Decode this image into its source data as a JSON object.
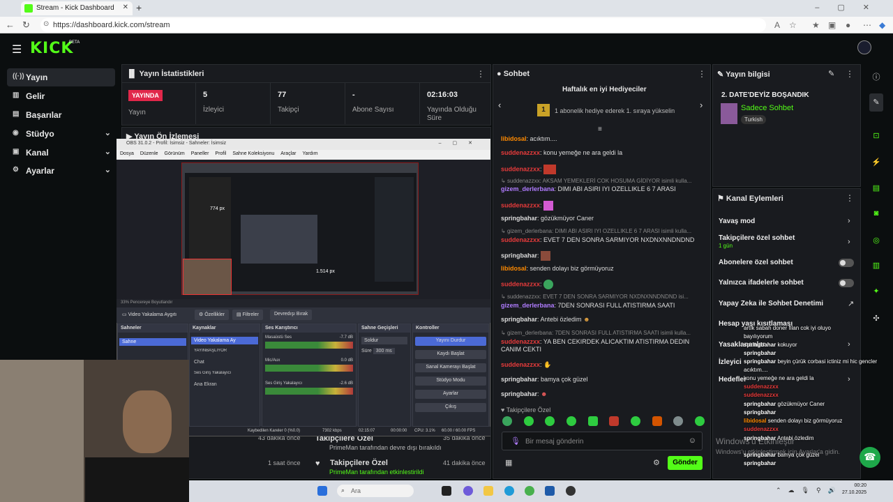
{
  "browser": {
    "tab_title": "Stream - Kick Dashboard",
    "url": "https://dashboard.kick.com/stream"
  },
  "header": {
    "logo": "KICK",
    "beta": "BETA"
  },
  "sidebar": {
    "items": [
      {
        "label": "Yayın",
        "icon": "broadcast-icon"
      },
      {
        "label": "Gelir",
        "icon": "money-icon"
      },
      {
        "label": "Başarılar",
        "icon": "trophy-icon"
      },
      {
        "label": "Stüdyo",
        "icon": "studio-icon"
      },
      {
        "label": "Kanal",
        "icon": "channel-icon"
      },
      {
        "label": "Ayarlar",
        "icon": "gear-icon"
      }
    ]
  },
  "stats": {
    "title": "Yayın İstatistikleri",
    "badge": "YAYINDA",
    "status_label": "Yayın",
    "viewers_value": "5",
    "viewers_label": "İzleyici",
    "followers_value": "77",
    "followers_label": "Takipçi",
    "subs_value": "-",
    "subs_label": "Abone Sayısı",
    "duration_value": "02:16:03",
    "duration_label": "Yayında Olduğu Süre"
  },
  "preview": {
    "title": "Yayın Ön İzlemesi"
  },
  "obs": {
    "title": "OBS 31.0.2 - Profil: İsimsiz - Sahneler: İsimsiz",
    "menu": [
      "Dosya",
      "Düzenle",
      "Görünüm",
      "Paneller",
      "Profil",
      "Sahne Koleksiyonu",
      "Araçlar",
      "Yardım"
    ],
    "zoom": "33%  Pencereye Boyutlandır",
    "source_name": "Video Yakalama Aygıtı",
    "toolbar": [
      "Özellikler",
      "Filtreler",
      "Devredışı Bırak"
    ],
    "docks": {
      "scenes": "Sahneler",
      "scene_item": "Sahne",
      "sources": "Kaynaklar",
      "source_items": [
        "Video Yakalama Ay",
        "YAYINBAŞLIYOR",
        "Chat",
        "Ses Giriş Yakalayıcı",
        "Ana Ekran"
      ],
      "mixer": "Ses Karıştırıcı",
      "mixer_items": [
        {
          "name": "Masaüstü Ses",
          "db": "-7.7 dB"
        },
        {
          "name": "Mic/Aux",
          "db": "0.0 dB"
        },
        {
          "name": "Ses Giriş Yakalayıcı",
          "db": "-2.6 dB"
        }
      ],
      "transitions": "Sahne Geçişleri",
      "transition_value": "Soldur",
      "duration_label": "Süre",
      "duration_value": "300 ms",
      "controls": "Kontroller",
      "control_items": [
        "Yayını Durdur",
        "Kaydı Başlat",
        "Sanal Kamerayı Başlat",
        "Stüdyo Modu",
        "Ayarlar",
        "Çıkış"
      ]
    },
    "footer": {
      "dropped": "Kaybedilen Kareler 0 (%0.0)",
      "kbps": "7302 kbps",
      "time1": "02:15:07",
      "time2": "00:00:00",
      "cpu": "CPU: 3.1%",
      "fps": "60.00 / 60.00 FPS"
    },
    "preview_label": "774 px",
    "preview_label2": "1.514 px"
  },
  "activity": [
    {
      "title": "Takipçilere Özel",
      "sub": "PrimeMan tarafından devre dışı bırakıldı",
      "time": "35 dakika önce",
      "prev_time": "43 dakika önce"
    },
    {
      "title": "Takipçilere Özel",
      "sub": "PrimeMan tarafından etkinleştirildi",
      "time": "41 dakika önce",
      "prev_time": "1 saat önce"
    }
  ],
  "chat": {
    "title": "Sohbet",
    "gifters_title": "Haftalık en iyi Hediyeciler",
    "gifters_rank": "1",
    "gifters_text": "1 abonelik hediye ederek 1. sıraya yükselin",
    "messages": [
      {
        "user": "libidosal",
        "color": "#ff8a00",
        "text": ": acıktım...."
      },
      {
        "user": "suddenazzxx",
        "color": "#e83b3b",
        "text": ": konu yemeğe ne ara geldi la"
      },
      {
        "user": "suddenazzxx",
        "color": "#e83b3b",
        "text": ":"
      },
      {
        "reply": "suddenazzxx: AKSAM YEMEKLERİ COK HOSUMA GİDİYOR isimli kulla..."
      },
      {
        "user": "gizem_derlerbana",
        "color": "#b07cff",
        "text": ": DIMI ABI ASIRI IYI OZELLIKLE 6 7 ARASI"
      },
      {
        "user": "suddenazzxx",
        "color": "#e83b3b",
        "text": ":"
      },
      {
        "user": "springbahar",
        "color": "#e6e6e6",
        "text": ": gözükmüyor Caner"
      },
      {
        "reply": "gizem_derlerbana: DIMI ABI ASIRI IYI OZELLIKLE 6 7 ARASI isimli kulla..."
      },
      {
        "user": "suddenazzxx",
        "color": "#e83b3b",
        "text": ": EVET 7 DEN SONRA SARMIYOR NXDNXNNDNDND"
      },
      {
        "user": "springbahar",
        "color": "#e6e6e6",
        "text": ":"
      },
      {
        "user": "libidosal",
        "color": "#ff8a00",
        "text": ": senden dolayı biz görmüyoruz"
      },
      {
        "user": "suddenazzxx",
        "color": "#e83b3b",
        "text": ":"
      },
      {
        "reply": "suddenazzxx: EVET 7 DEN SONRA SARMIYOR NXDNXNNDNDND isi..."
      },
      {
        "user": "gizem_derlerbana",
        "color": "#b07cff",
        "text": ": 7DEN SONRASI FULL ATISTIRMA SAATI"
      },
      {
        "user": "springbahar",
        "color": "#e6e6e6",
        "text": ": Antebi özledim"
      },
      {
        "reply": "gizem_derlerbana: 7DEN SONRASI FULL ATISTIRMA SAATI isimli kulla..."
      },
      {
        "user": "suddenazzxx",
        "color": "#e83b3b",
        "text": ": YA BEN CEKIRDEK ALICAKTIM ATISTIRMA DEDIN CANIM CEKTI"
      },
      {
        "user": "suddenazzxx",
        "color": "#e83b3b",
        "text": ":"
      },
      {
        "user": "springbahar",
        "color": "#e6e6e6",
        "text": ": bamya çok güzel"
      },
      {
        "user": "springbahar",
        "color": "#e6e6e6",
        "text": ":"
      }
    ],
    "followers_only": "Takipçilere Özel",
    "input_placeholder": "Bir mesaj gönderin",
    "send_label": "Gönder"
  },
  "stream_info": {
    "title": "Yayın bilgisi",
    "stream_title": "2. DATE'DEYİZ BOŞANDIK",
    "category": "Sadece Sohbet",
    "tag": "Turkish"
  },
  "channel_actions": {
    "title": "Kanal Eylemleri",
    "items": [
      {
        "label": "Yavaş mod",
        "sub": ""
      },
      {
        "label": "Takipçilere özel sohbet",
        "sub": "1 gün"
      },
      {
        "label": "Abonelere özel sohbet",
        "sub": ""
      },
      {
        "label": "Yalnızca ifadelerle sohbet",
        "sub": ""
      },
      {
        "label": "Yapay Zeka ile Sohbet Denetimi",
        "sub": ""
      },
      {
        "label": "Hesap yaşı kısıtlaması",
        "sub": ""
      },
      {
        "label": "Yasaklananlar",
        "sub": ""
      },
      {
        "label": "İzleyici",
        "sub": ""
      },
      {
        "label": "Hedefler",
        "sub": ""
      }
    ]
  },
  "overlay_chat": [
    {
      "user": "",
      "text": "artık sabah doner filan cok iyi oluyo"
    },
    {
      "user": "",
      "text": "bayılıyorum"
    },
    {
      "user": "springbahar",
      "text": "kokuyor"
    },
    {
      "user": "springbahar",
      "text": ""
    },
    {
      "user": "springbahar",
      "text": "beyin çürük corbasi ictiniz mi hic gencler"
    },
    {
      "user": "",
      "text": "acıktım...."
    },
    {
      "user": "",
      "text": "konu yemeğe ne ara geldi la"
    },
    {
      "user": "suddenazzxx",
      "text": ""
    },
    {
      "user": "suddenazzxx",
      "text": ""
    },
    {
      "user": "springbahar",
      "text": "gözükmüyor Caner"
    },
    {
      "user": "springbahar",
      "text": ""
    },
    {
      "user": "libidosal",
      "text": "senden dolayı biz görmüyoruz"
    },
    {
      "user": "suddenazzxx",
      "text": ""
    },
    {
      "user": "springbahar",
      "text": "Antebi özledim"
    },
    {
      "user": "springbahar",
      "text": "bamya çok güzel"
    },
    {
      "user": "springbahar",
      "text": ""
    }
  ],
  "watermark": {
    "line1": "Windows'u Etkinleştir",
    "line2": "Windows'u etkinleştirmek için Ayarlar'a gidin."
  },
  "taskbar": {
    "search": "Ara",
    "time": "00:20",
    "date": "27.10.2025"
  }
}
